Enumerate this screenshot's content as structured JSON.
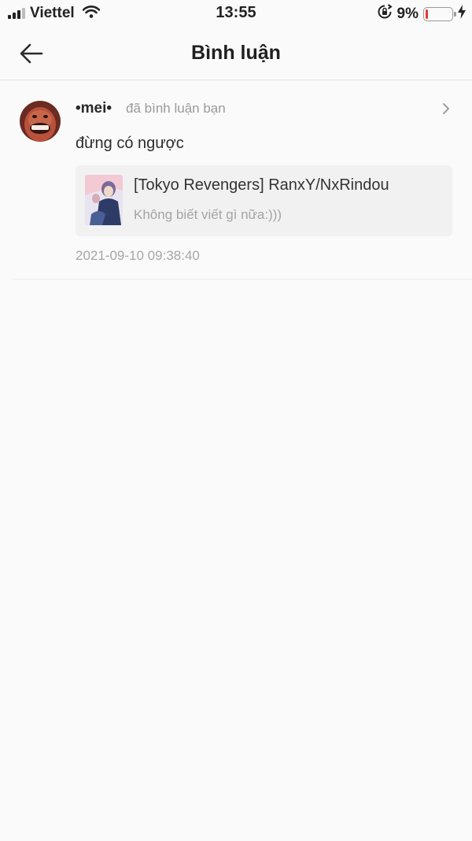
{
  "status_bar": {
    "carrier": "Viettel",
    "time": "13:55",
    "battery_percent": "9%",
    "battery_level": 0.09,
    "signal_bars": 3,
    "icons": [
      "signal-icon",
      "wifi-icon",
      "orientation-lock-icon",
      "battery-icon",
      "charging-icon"
    ]
  },
  "header": {
    "title": "Bình luận",
    "back_icon": "arrow-left-icon"
  },
  "notifications": [
    {
      "username": "•mei•",
      "action": "đã bình luận bạn",
      "comment": "đừng có ngược",
      "post": {
        "title": "[Tokyo Revengers] RanxY/NxRindou",
        "description": "Không biết viết gì nữa:)))"
      },
      "timestamp": "2021-09-10 09:38:40"
    }
  ],
  "colors": {
    "background": "#fafafa",
    "card": "#f1f1f1",
    "muted_text": "#a4a4a4",
    "battery_low": "#e53935"
  }
}
